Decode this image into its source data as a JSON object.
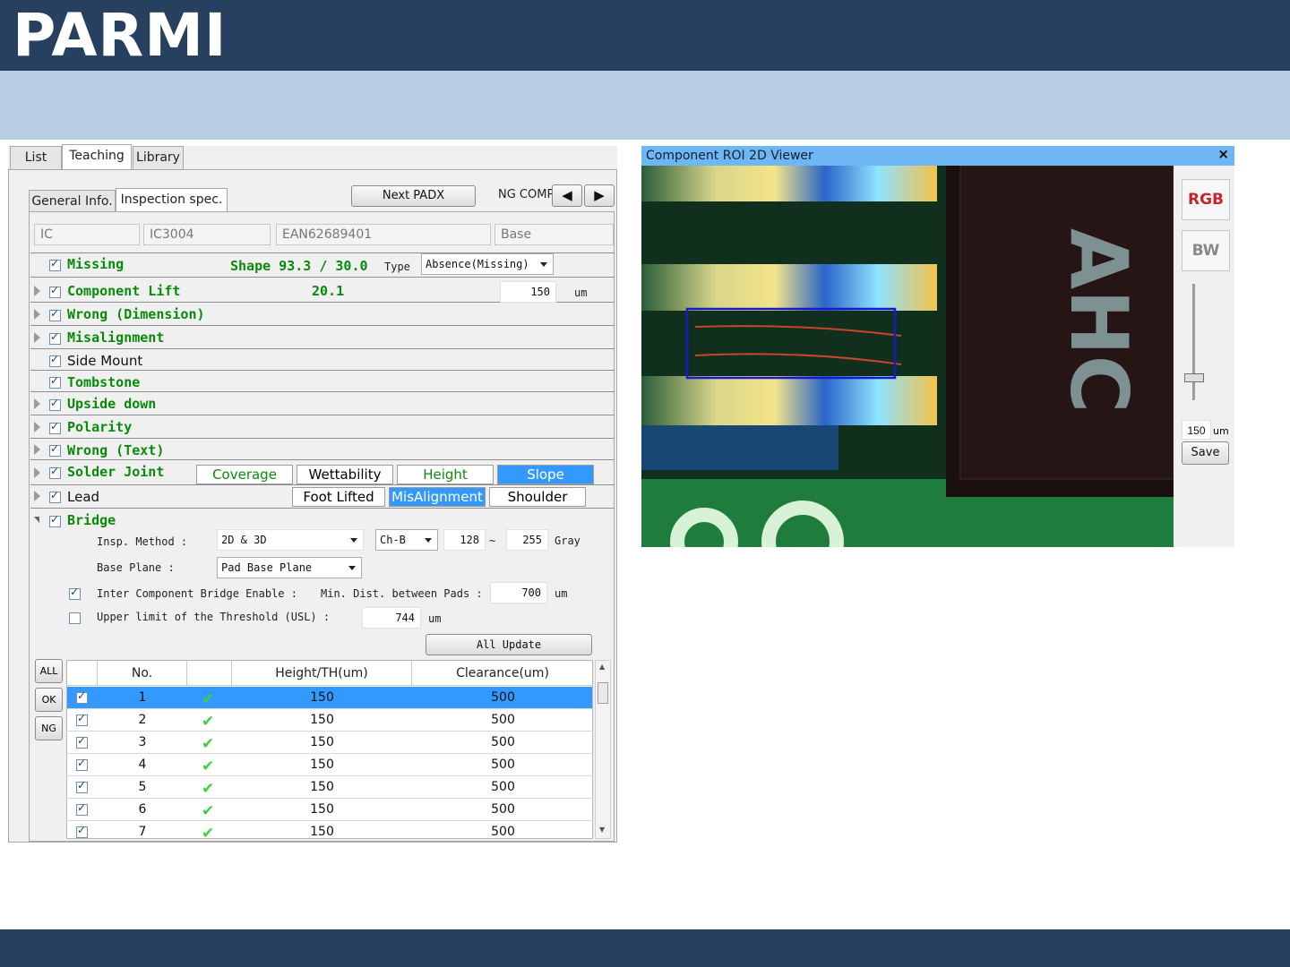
{
  "brand": {
    "logo_text": "PARMI"
  },
  "tabs": {
    "list": "List",
    "teaching": "Teaching",
    "library": "Library"
  },
  "subtabs": {
    "general": "General Info.",
    "inspection": "Inspection spec."
  },
  "toolbar": {
    "next_padx": "Next PADX",
    "ng_comp": "NG COMP"
  },
  "info_fields": [
    "IC",
    "IC3004",
    "EAN62689401",
    "Base"
  ],
  "rows": {
    "missing": {
      "label": "Missing",
      "shape": "Shape 93.3 / 30.0",
      "type_label": "Type",
      "type_value": "Absence(Missing)"
    },
    "component_lift": {
      "label": "Component  Lift",
      "value": "20.1",
      "input": "150",
      "unit": "um"
    },
    "wrong_dim": {
      "label": "Wrong (Dimension)"
    },
    "misalignment": {
      "label": "Misalignment"
    },
    "side_mount": {
      "label": "Side Mount"
    },
    "tombstone": {
      "label": "Tombstone"
    },
    "upside_down": {
      "label": "Upside down"
    },
    "polarity": {
      "label": "Polarity"
    },
    "wrong_text": {
      "label": "Wrong (Text)"
    },
    "solder_joint": {
      "label": "Solder Joint",
      "segments": [
        "Coverage",
        "Wettability",
        "Height",
        "Slope"
      ],
      "selected": "Slope"
    },
    "lead": {
      "label": "Lead",
      "segments": [
        "Foot Lifted",
        "MisAlignment",
        "Shoulder"
      ],
      "selected": "MisAlignment"
    },
    "bridge": {
      "label": "Bridge"
    }
  },
  "bridge": {
    "insp_method_label": "Insp. Method :",
    "insp_method_value": "2D & 3D",
    "channel": "Ch-B",
    "min": "128",
    "tilde": "~",
    "max": "255",
    "gray": "Gray",
    "base_plane_label": "Base Plane :",
    "base_plane_value": "Pad Base Plane",
    "inter_enable_label": "Inter Component Bridge Enable :",
    "min_dist_label": "Min. Dist. between Pads :",
    "min_dist_value": "700",
    "min_dist_unit": "um",
    "usl_label": "Upper limit of the Threshold (USL)  :",
    "usl_value": "744",
    "usl_unit": "um",
    "all_update": "All Update"
  },
  "side_buttons": {
    "all": "ALL",
    "ok": "OK",
    "ng": "NG"
  },
  "table": {
    "headers": [
      "",
      "No.",
      "",
      "Height/TH(um)",
      "Clearance(um)"
    ],
    "rows": [
      {
        "no": "1",
        "height": "150",
        "clearance": "500"
      },
      {
        "no": "2",
        "height": "150",
        "clearance": "500"
      },
      {
        "no": "3",
        "height": "150",
        "clearance": "500"
      },
      {
        "no": "4",
        "height": "150",
        "clearance": "500"
      },
      {
        "no": "5",
        "height": "150",
        "clearance": "500"
      },
      {
        "no": "6",
        "height": "150",
        "clearance": "500"
      },
      {
        "no": "7",
        "height": "150",
        "clearance": "500"
      }
    ]
  },
  "viewer": {
    "title": "Component ROI 2D Viewer",
    "close": "×",
    "rgb": "RGB",
    "bw": "BW",
    "value": "150",
    "unit": "um",
    "save": "Save",
    "component_text": "AHC"
  },
  "colors": {
    "header": "#27405f",
    "subbar": "#b8cce4",
    "selection": "#3399ff",
    "green_label": "#0a8a0a",
    "viewer_title": "#6fb6f4"
  }
}
